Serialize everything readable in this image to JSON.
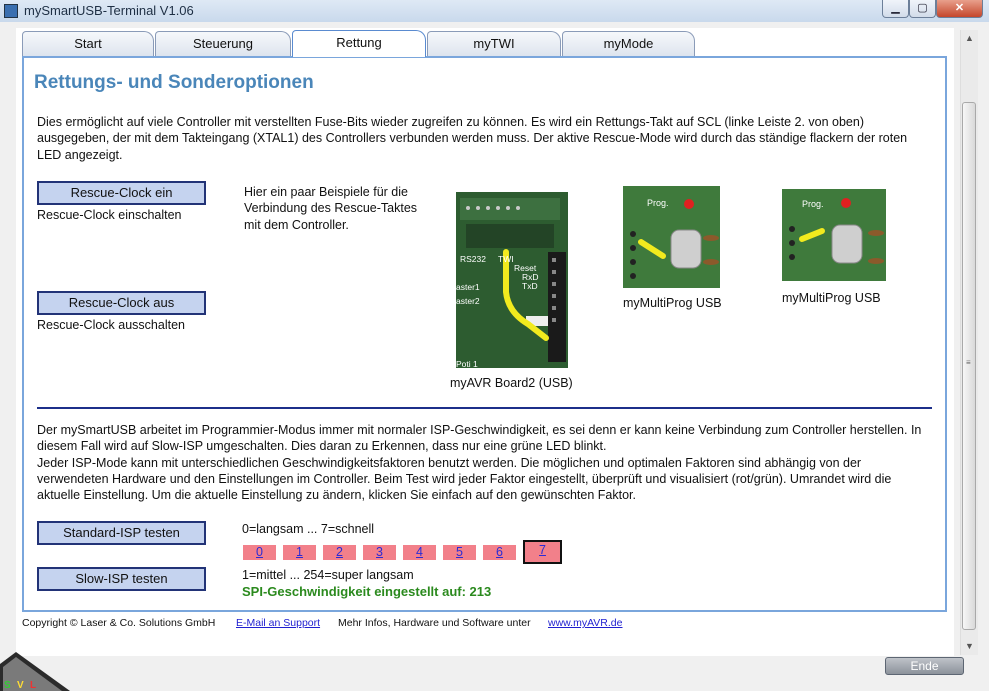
{
  "window": {
    "title": "mySmartUSB-Terminal V1.06",
    "min_glyph": "▁",
    "max_glyph": "▢",
    "close_glyph": "✕"
  },
  "tabs": [
    {
      "label": "Start",
      "active": false
    },
    {
      "label": "Steuerung",
      "active": false
    },
    {
      "label": "Rettung",
      "active": true
    },
    {
      "label": "myTWI",
      "active": false
    },
    {
      "label": "myMode",
      "active": false
    }
  ],
  "rettung": {
    "heading": "Rettungs- und Sonderoptionen",
    "intro": "Dies ermöglicht auf viele Controller mit verstellten Fuse-Bits wieder zugreifen zu können. Es wird ein Rettungs-Takt auf SCL (linke Leiste 2. von oben) ausgegeben, der mit dem Takteingang (XTAL1) des Controllers verbunden werden muss. Der aktive Rescue-Mode wird durch das ständige flackern der roten LED angezeigt.",
    "rescue_on_button": "Rescue-Clock ein",
    "rescue_on_label": "Rescue-Clock einschalten",
    "rescue_off_button": "Rescue-Clock aus",
    "rescue_off_label": "Rescue-Clock ausschalten",
    "examples_text": "Hier ein paar Beispiele für die Verbindung des Rescue-Taktes mit dem Controller.",
    "photos": [
      {
        "caption": "myAVR Board2 (USB)",
        "labels": [
          "RS232",
          "TWI",
          "Reset",
          "RxD",
          "TxD",
          "aster1",
          "aster2",
          "Poti 1"
        ]
      },
      {
        "caption": "myMultiProg USB",
        "labels": [
          "Prog."
        ]
      },
      {
        "caption": "myMultiProg USB",
        "labels": [
          "Prog."
        ]
      }
    ],
    "isp_text": "Der mySmartUSB arbeitet im Programmier-Modus immer mit normaler ISP-Geschwindigkeit, es sei denn er kann keine Verbindung zum Controller herstellen. In diesem Fall wird auf Slow-ISP umgeschalten. Dies daran zu Erkennen, dass nur eine grüne LED blinkt.\nJeder ISP-Mode kann mit unterschiedlichen Geschwindigkeitsfaktoren benutzt werden. Die möglichen und optimalen Faktoren sind abhängig von der verwendeten Hardware und den Einstellungen im Controller. Beim Test wird jeder Faktor eingestellt, überprüft und visualisiert (rot/grün). Umrandet wird die aktuelle Einstellung. Um die aktuelle Einstellung zu ändern, klicken Sie einfach auf den gewünschten Faktor.",
    "standard_isp_button": "Standard-ISP testen",
    "standard_range": "0=langsam ... 7=schnell",
    "factors": [
      "0",
      "1",
      "2",
      "3",
      "4",
      "5",
      "6",
      "7"
    ],
    "selected_factor": "7",
    "factor_color": "#f2808a",
    "slow_isp_button": "Slow-ISP testen",
    "slow_range": "1=mittel ... 254=super langsam",
    "spi_status": "SPI-Geschwindigkeit eingestellt auf: 213",
    "status_color": "#2b8a1e"
  },
  "footer": {
    "copyright": "Copyright © Laser & Co. Solutions GmbH",
    "email_link": "E-Mail an Support",
    "more_info": "Mehr Infos, Hardware und Software unter",
    "web_link": "www.myAVR.de"
  },
  "ende_button": "Ende",
  "logo_letters": [
    "S",
    "V",
    "L"
  ]
}
